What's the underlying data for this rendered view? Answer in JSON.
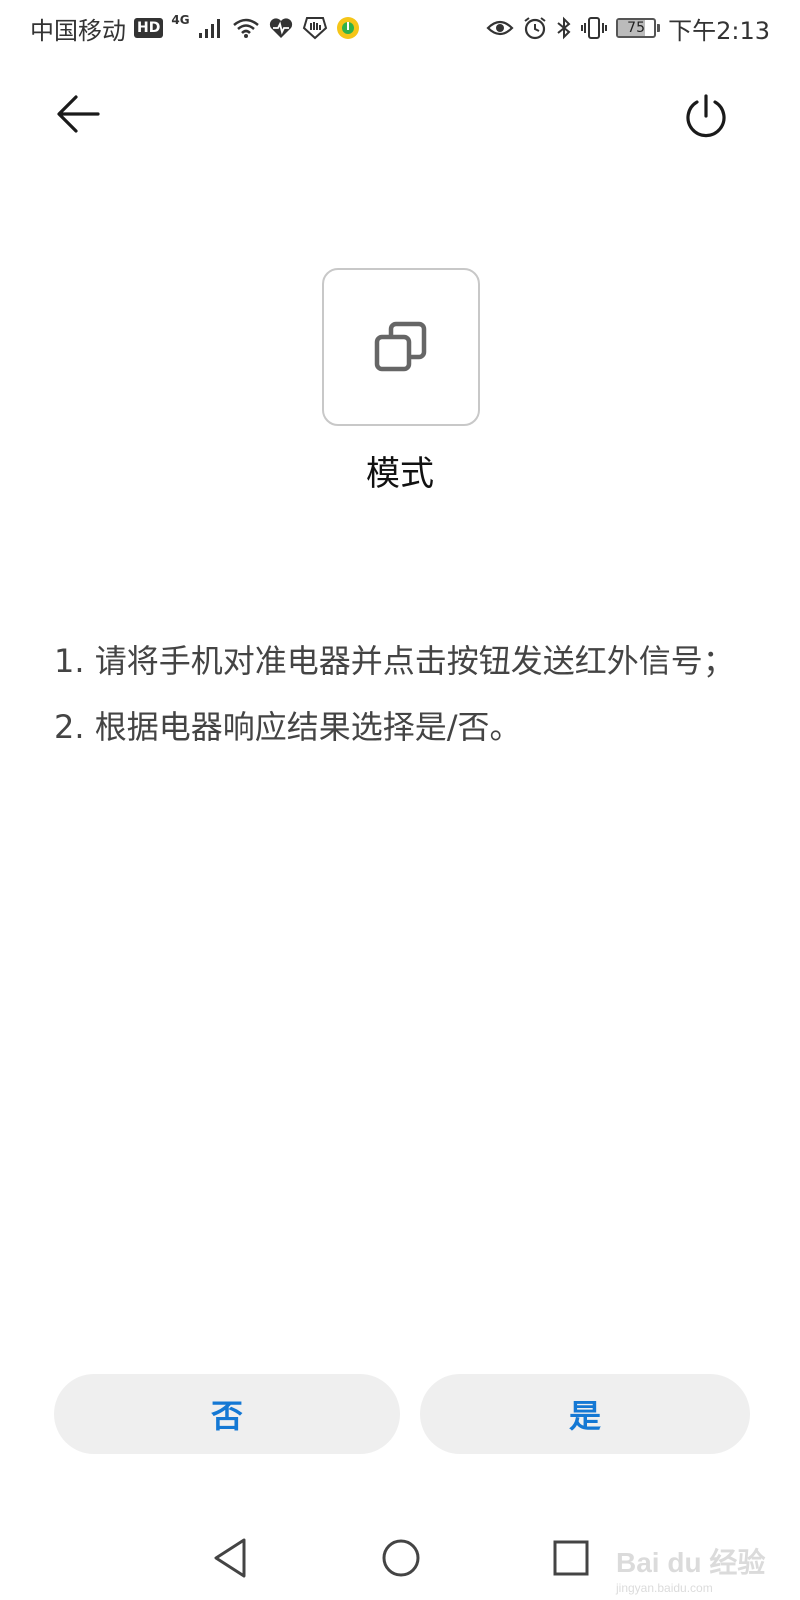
{
  "status_bar": {
    "carrier": "中国移动",
    "hd": "HD",
    "network": "4G",
    "battery_level": "75",
    "battery_fraction": 0.75,
    "time": "下午2:13"
  },
  "mode": {
    "label": "模式",
    "icon": "copy-icon"
  },
  "instructions": [
    "1. 请将手机对准电器并点击按钮发送红外信号；",
    "2. 根据电器响应结果选择是/否。"
  ],
  "buttons": {
    "no_label": "否",
    "yes_label": "是"
  },
  "colors": {
    "accent": "#1478d4",
    "button_bg": "#efefef",
    "tile_border": "#c8c8c8"
  },
  "watermark": {
    "text": "Bai du 经验",
    "url_text": "jingyan.baidu.com"
  }
}
